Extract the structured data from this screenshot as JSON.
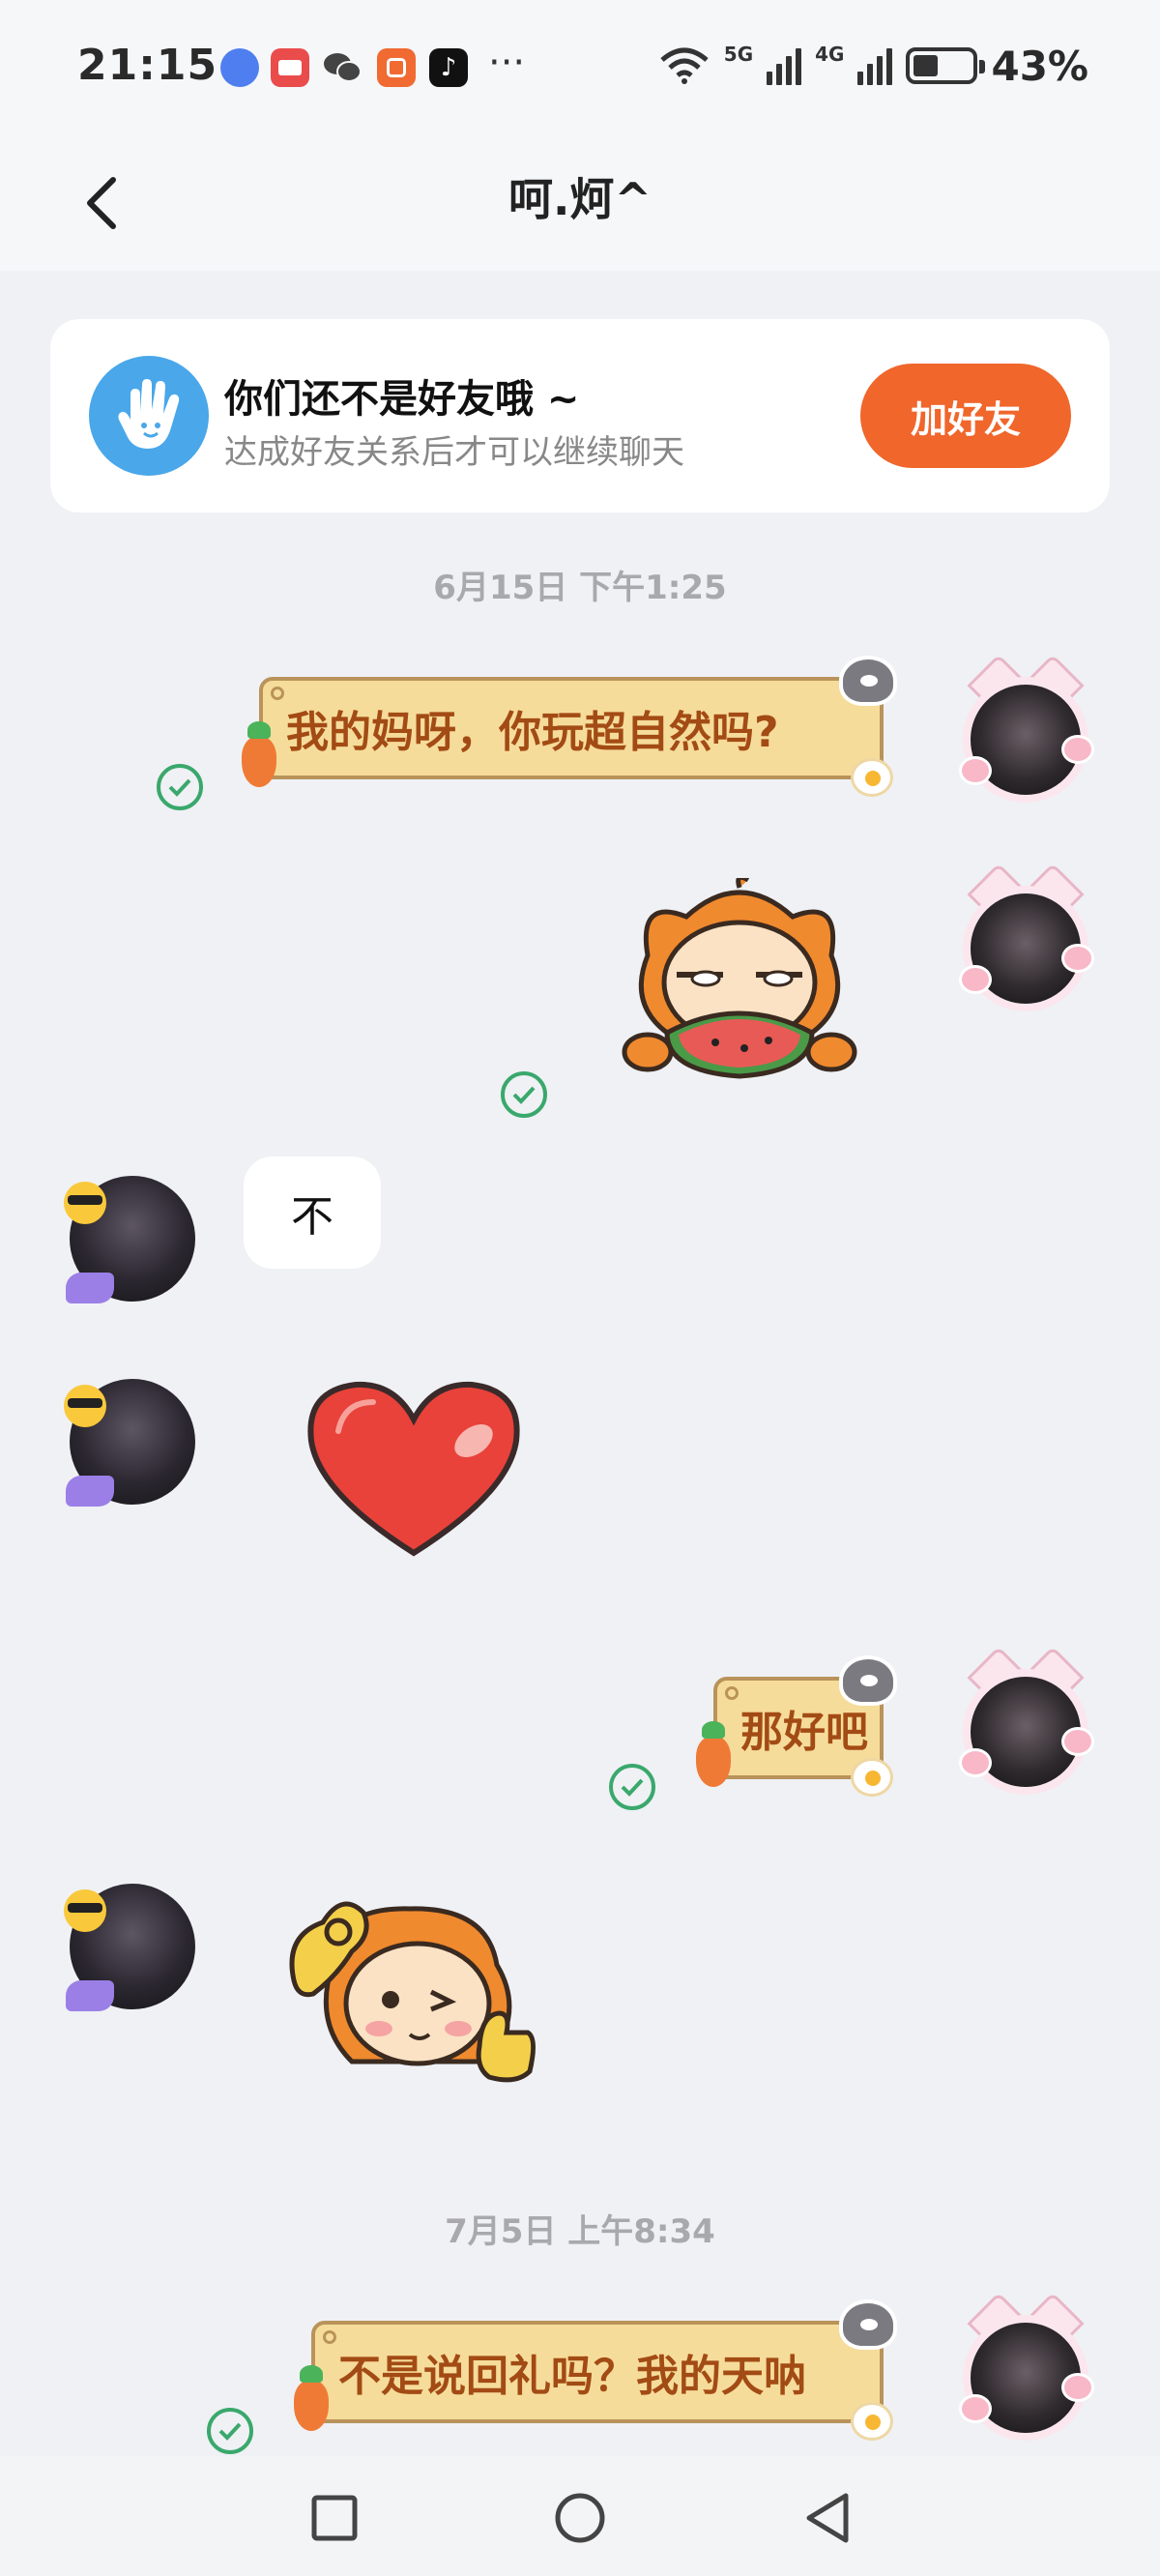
{
  "status_bar": {
    "time": "21:15",
    "apps": [
      {
        "name": "browser-app-icon",
        "color": "#4f7ef0",
        "glyph": "●"
      },
      {
        "name": "red-app-icon",
        "color": "#ea4b4b",
        "glyph": "▬"
      },
      {
        "name": "wechat-app-icon",
        "color": "#4a4a4a",
        "glyph": "◎"
      },
      {
        "name": "orange-app-icon",
        "color": "#f06a32",
        "glyph": "≡"
      },
      {
        "name": "tiktok-app-icon",
        "color": "#111111",
        "glyph": "♪"
      }
    ],
    "more": "···",
    "net_5g": "5G",
    "net_4g": "4G",
    "battery_percent_text": "43%",
    "battery_level": 0.43
  },
  "header": {
    "title": "呵.炣^"
  },
  "friend_card": {
    "title": "你们还不是好友哦 ~",
    "subtitle": "达成好友关系后才可以继续聊天",
    "button": "加好友"
  },
  "timestamps": {
    "first": "6月15日 下午1:25",
    "second": "7月5日 上午8:34"
  },
  "messages": {
    "m1": "我的妈呀，你玩超自然吗?",
    "m3": "不",
    "m5": "那好吧",
    "m7": "不是说回礼吗？我的天呐"
  },
  "colors": {
    "accent": "#f0662b",
    "read_check": "#3aa86c",
    "bubble_fill": "#f6dc9a",
    "bubble_text": "#a34b15"
  }
}
